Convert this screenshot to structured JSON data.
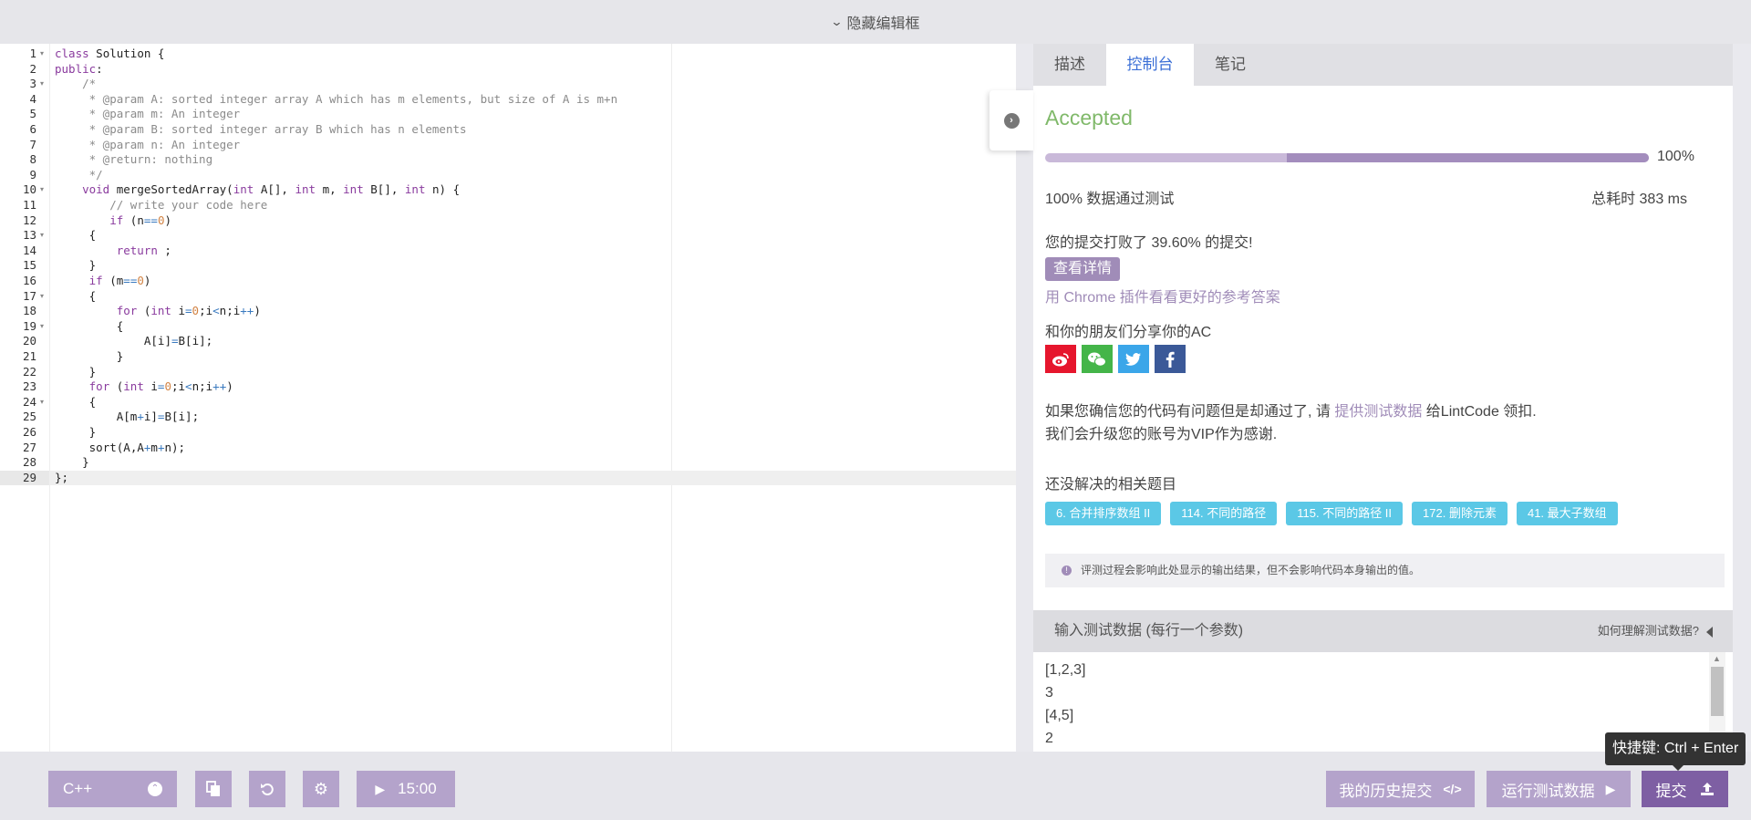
{
  "topbar": {
    "label": "隐藏编辑框"
  },
  "editor": {
    "line_numbers": [
      "1",
      "2",
      "3",
      "4",
      "5",
      "6",
      "7",
      "8",
      "9",
      "10",
      "11",
      "12",
      "13",
      "14",
      "15",
      "16",
      "17",
      "18",
      "19",
      "20",
      "21",
      "22",
      "23",
      "24",
      "25",
      "26",
      "27",
      "28",
      "29"
    ],
    "lines": [
      "class Solution {",
      "public:",
      "    /*",
      "     * @param A: sorted integer array A which has m elements, but size of A is m+n",
      "     * @param m: An integer",
      "     * @param B: sorted integer array B which has n elements",
      "     * @param n: An integer",
      "     * @return: nothing",
      "     */",
      "    void mergeSortedArray(int A[], int m, int B[], int n) {",
      "        // write your code here",
      "        if (n==0)",
      "     {",
      "         return ;",
      "     }",
      "     if (m==0)",
      "     {",
      "         for (int i=0;i<n;i++)",
      "         {",
      "             A[i]=B[i];",
      "         }",
      "     }",
      "     for (int i=0;i<n;i++)",
      "     {",
      "         A[m+i]=B[i];",
      "     }",
      "     sort(A,A+m+n);",
      "    }",
      "};"
    ]
  },
  "panel": {
    "tabs": [
      "描述",
      "控制台",
      "笔记"
    ],
    "active_tab": "控制台",
    "status": "Accepted",
    "progress_percent": 100,
    "progress_label": "100%",
    "passed_text": "100% 数据通过测试",
    "elapsed_text": "总耗时 383 ms",
    "beat_text": "您的提交打败了 39.60% 的提交!",
    "detail_button": "查看详情",
    "chrome_link": "用 Chrome 插件看看更好的参考答案",
    "share_title": "和你的朋友们分享你的AC",
    "social_icons": [
      "weibo-icon",
      "wechat-icon",
      "twitter-icon",
      "facebook-icon"
    ],
    "note_prefix": "如果您确信您的代码有问题但是却通过了, 请 ",
    "note_link": "提供测试数据",
    "note_suffix": " 给LintCode 领扣.",
    "note_line2": "我们会升级您的账号为VIP作为感谢.",
    "related_title": "还没解决的相关题目",
    "related": [
      "6. 合并排序数组 II",
      "114. 不同的路径",
      "115. 不同的路径 II",
      "172. 删除元素",
      "41. 最大子数组"
    ],
    "info_text": "评测过程会影响此处显示的输出结果，但不会影响代码本身输出的值。",
    "input_header": "输入测试数据 (每行一个参数)",
    "input_help": "如何理解测试数据?",
    "input_lines": [
      "[1,2,3]",
      "3",
      "[4,5]",
      "2"
    ]
  },
  "toolbar": {
    "language": "C++",
    "timer": "15:00",
    "history_label": "我的历史提交",
    "run_label": "运行测试数据",
    "submit_label": "提交",
    "tooltip_prefix": "快捷键: ",
    "tooltip_keys": "Ctrl + Enter"
  },
  "colors": {
    "accent": "#a08cb8",
    "accepted": "#80b96a",
    "chip": "#5bc8e6",
    "active_tab": "#3b6fd6"
  }
}
